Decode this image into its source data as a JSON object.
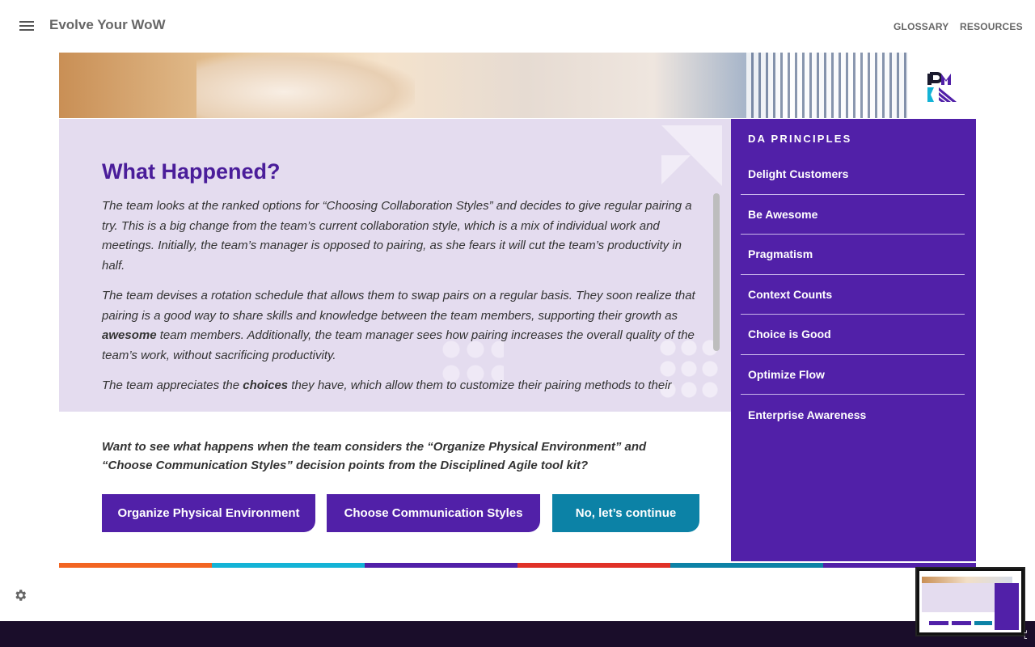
{
  "header": {
    "app_title": "Evolve Your WoW",
    "nav": [
      {
        "label": "GLOSSARY"
      },
      {
        "label": "RESOURCES"
      }
    ],
    "menu_icon": "hamburger-menu-icon"
  },
  "logo": {
    "text": "PMI",
    "colors": {
      "p": "#1a1a2e",
      "m": "#5120a8",
      "accent": "#14b3d6"
    }
  },
  "main": {
    "heading": "What Happened?",
    "paragraphs": [
      {
        "segments": [
          {
            "text": "The team looks at the ranked options for “Choosing Collaboration Styles” and decides to give regular pairing a try. This is a big change from the team’s current collaboration style, which is a mix of individual work and meetings. Initially, the team’s manager is opposed to pairing, as she fears it will cut the team’s productivity in half.",
            "bold": false
          }
        ]
      },
      {
        "segments": [
          {
            "text": "The team devises a rotation schedule that allows them to swap pairs on a regular basis. They soon realize that pairing is a good way to share skills and knowledge between the team members, supporting their growth as ",
            "bold": false
          },
          {
            "text": "awesome",
            "bold": true
          },
          {
            "text": " team members. Additionally, the team manager sees how pairing increases the overall quality of the team’s work, without sacrificing productivity.",
            "bold": false
          }
        ]
      },
      {
        "segments": [
          {
            "text": "The team appreciates the ",
            "bold": false
          },
          {
            "text": "choices",
            "bold": true
          },
          {
            "text": " they have, which allow them to customize their pairing methods to their",
            "bold": false
          }
        ]
      }
    ],
    "question": "Want to see what happens when the team considers the “Organize Physical Environment” and “Choose Communication Styles” decision points from the Disciplined Agile tool kit?",
    "buttons": [
      {
        "label": "Organize Physical Environment"
      },
      {
        "label": "Choose Communication Styles"
      },
      {
        "label": "No, let’s continue"
      }
    ]
  },
  "sidebar": {
    "title": "DA PRINCIPLES",
    "items": [
      {
        "label": "Delight Customers"
      },
      {
        "label": "Be Awesome"
      },
      {
        "label": "Pragmatism"
      },
      {
        "label": "Context Counts"
      },
      {
        "label": "Choice is Good"
      },
      {
        "label": "Optimize Flow"
      },
      {
        "label": "Enterprise Awareness"
      }
    ]
  },
  "stripe_colors": [
    "#f26522",
    "#14b3d6",
    "#5120a8",
    "#e03127",
    "#0c82a6",
    "#5120a8"
  ],
  "colors": {
    "purple": "#5120a8",
    "teal": "#0c82a6",
    "lavender": "#e4dcef",
    "footer": "#1a0d2a"
  },
  "icons": {
    "settings": "gear-icon",
    "resize": "resize-handle-icon"
  }
}
